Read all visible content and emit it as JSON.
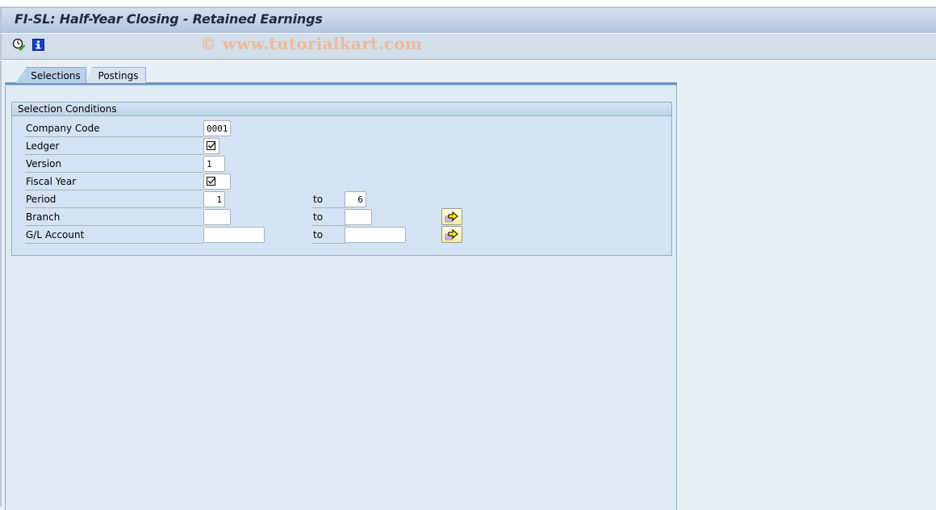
{
  "window": {
    "title": "FI-SL: Half-Year Closing - Retained Earnings"
  },
  "toolbar": {
    "buttons": [
      {
        "icon": "execute-clock-icon",
        "tooltip": ""
      },
      {
        "icon": "info-icon",
        "tooltip": ""
      }
    ],
    "watermark": "© www.tutorialkart.com"
  },
  "tabs": [
    {
      "label": "Selections",
      "active": true
    },
    {
      "label": "Postings",
      "active": false
    }
  ],
  "selection_conditions": {
    "title": "Selection Conditions",
    "to_label": "to",
    "rows": [
      {
        "label": "Company Code",
        "value": "0001",
        "type": "text"
      },
      {
        "label": "Ledger",
        "checked": true,
        "type": "checkbox"
      },
      {
        "label": "Version",
        "value": "1",
        "type": "text"
      },
      {
        "label": "Fiscal Year",
        "checked": true,
        "type": "checkbox"
      },
      {
        "label": "Period",
        "from": "1",
        "to": "6",
        "type": "range"
      },
      {
        "label": "Branch",
        "from": "",
        "to": "",
        "type": "range",
        "multiple_selection": true
      },
      {
        "label": "G/L Account",
        "from": "",
        "to": "",
        "type": "range",
        "multiple_selection": true
      }
    ]
  }
}
